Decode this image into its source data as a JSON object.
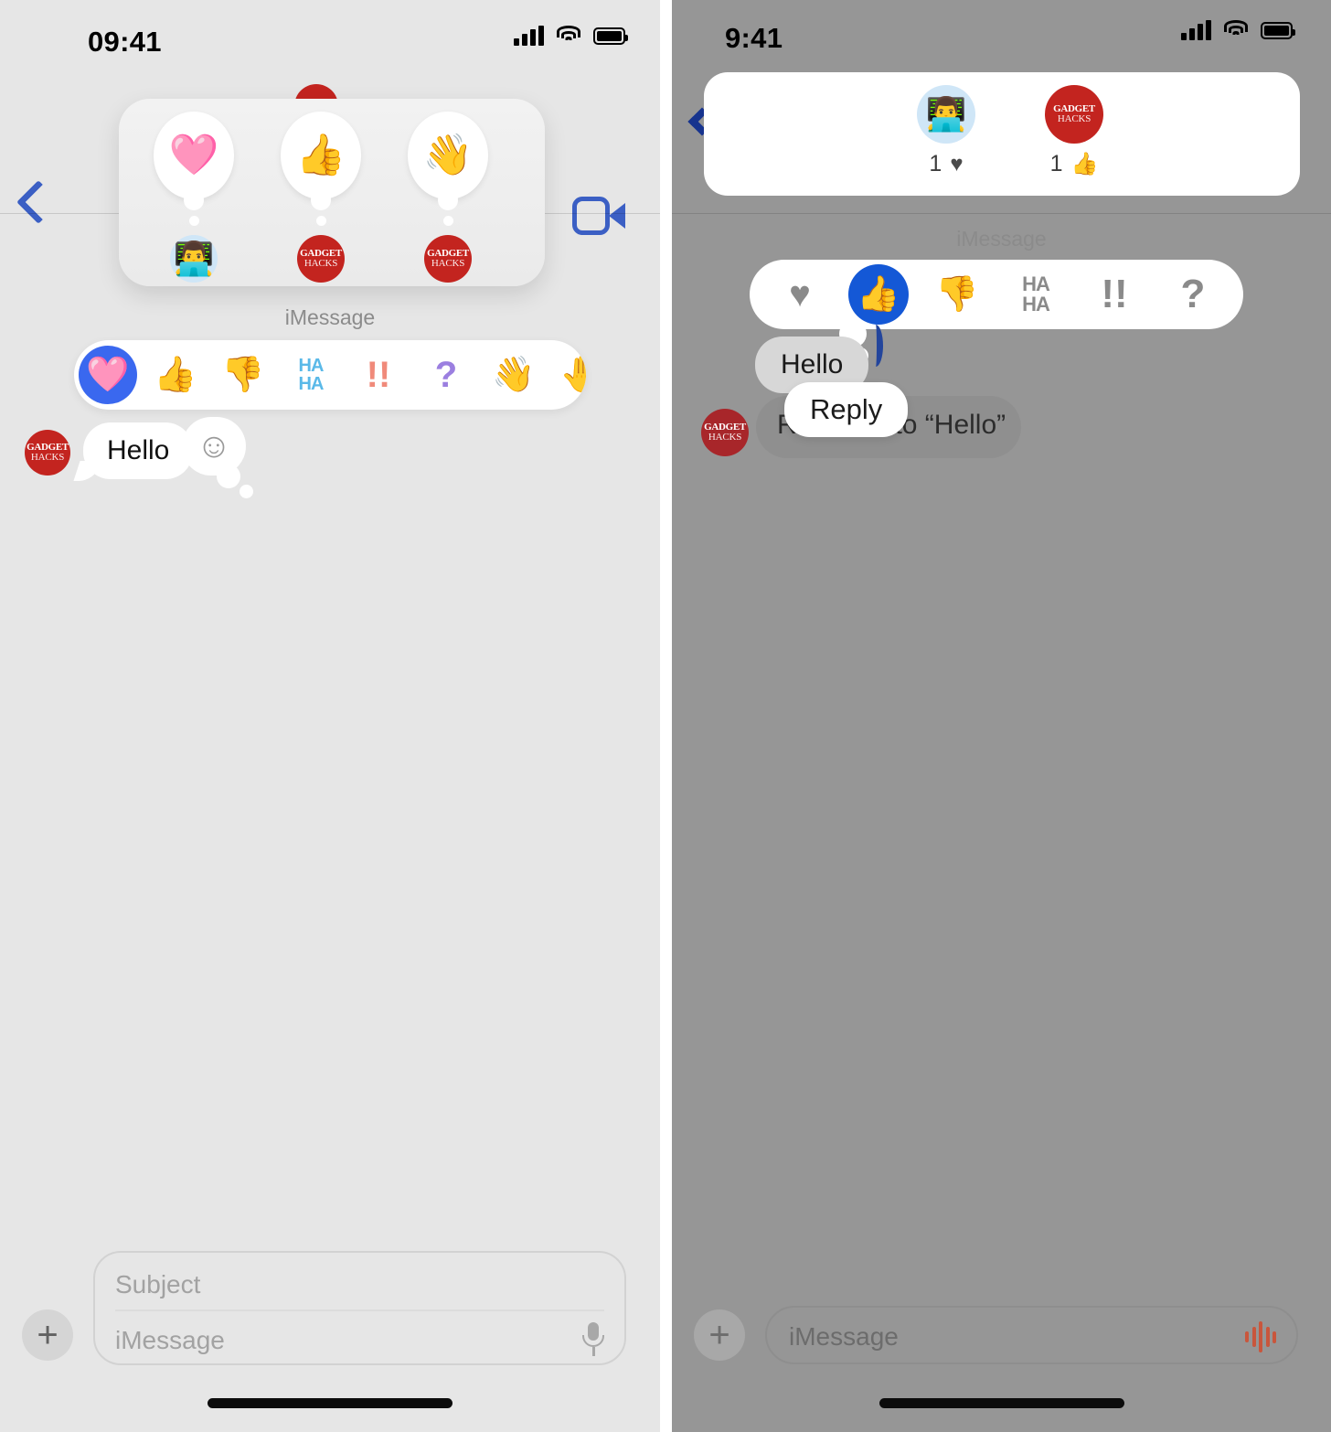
{
  "left_panel": {
    "status_bar": {
      "time": "09:41",
      "cellular_icon": "signal-bars-icon",
      "wifi_icon": "wifi-icon",
      "battery_icon": "battery-icon"
    },
    "nav": {
      "back_icon": "back-chevron-icon",
      "facetime_icon": "video-camera-icon"
    },
    "reaction_detail_popup": {
      "entries": [
        {
          "reaction": "🩷",
          "reaction_name": "pink-heart",
          "sender_avatar": "memoji-avatar",
          "sender_label": ""
        },
        {
          "reaction": "👍",
          "reaction_name": "thumbs-up",
          "sender_avatar": "gadget-hacks-avatar",
          "sender_label": "GADGET HACKS"
        },
        {
          "reaction": "👋",
          "reaction_name": "waving-hand",
          "sender_avatar": "gadget-hacks-avatar",
          "sender_label": "GADGET HACKS"
        }
      ]
    },
    "section_label": "iMessage",
    "tapback_bar": {
      "items": [
        {
          "name": "heart-reaction",
          "glyph": "🩷",
          "selected": true
        },
        {
          "name": "thumbs-up-reaction",
          "glyph": "👍",
          "selected": false
        },
        {
          "name": "thumbs-down-reaction",
          "glyph": "👎",
          "selected": false
        },
        {
          "name": "haha-reaction",
          "glyph": "HA\nHA",
          "selected": false
        },
        {
          "name": "exclamation-reaction",
          "glyph": "!!",
          "selected": false
        },
        {
          "name": "question-reaction",
          "glyph": "?",
          "selected": false
        },
        {
          "name": "wave-reaction",
          "glyph": "👋",
          "selected": false
        },
        {
          "name": "partial-reaction",
          "glyph": "🤚",
          "selected": false
        }
      ]
    },
    "message": {
      "avatar": "gadget-hacks-avatar",
      "text": "Hello",
      "sticker_icon": "smiley-face-icon"
    },
    "composer": {
      "add_button": "+",
      "subject_placeholder": "Subject",
      "message_placeholder": "iMessage",
      "mic_icon": "microphone-icon"
    },
    "avatar_logo": {
      "line1": "GADGET",
      "line2": "HACKS"
    }
  },
  "right_panel": {
    "status_bar": {
      "time": "9:41",
      "cellular_icon": "signal-bars-icon",
      "wifi_icon": "wifi-icon",
      "battery_icon": "battery-icon"
    },
    "nav": {
      "back_icon": "back-chevron-icon"
    },
    "reaction_summary_card": {
      "entries": [
        {
          "avatar": "memoji-avatar",
          "count": "1",
          "reaction_icon": "heart-icon",
          "reaction_glyph": "♥"
        },
        {
          "avatar": "gadget-hacks-avatar",
          "count": "1",
          "reaction_icon": "thumbs-up-icon",
          "reaction_glyph": "👍"
        }
      ]
    },
    "section_label": "iMessage",
    "tapback_bar": {
      "items": [
        {
          "name": "heart-reaction",
          "glyph": "♥",
          "selected": false
        },
        {
          "name": "thumbs-up-reaction",
          "glyph": "👍",
          "selected": true
        },
        {
          "name": "thumbs-down-reaction",
          "glyph": "👎",
          "selected": false
        },
        {
          "name": "haha-reaction",
          "glyph": "HA HA",
          "selected": false
        },
        {
          "name": "exclamation-reaction",
          "glyph": "!!",
          "selected": false
        },
        {
          "name": "question-reaction",
          "glyph": "?",
          "selected": false
        }
      ]
    },
    "conversation": {
      "incoming_text": "Hello",
      "reaction_notice": "to “Hello”",
      "reaction_notice_prefix": "R",
      "avatar": "gadget-hacks-avatar"
    },
    "context_menu": {
      "reply_label": "Reply"
    },
    "composer": {
      "add_button": "+",
      "message_placeholder": "iMessage",
      "audio_icon": "audio-waveform-icon"
    },
    "avatar_logo": {
      "line1": "GADGET",
      "line2": "HACKS"
    }
  },
  "colors": {
    "accent_blue": "#3a68ef",
    "selected_blue": "#1458d6",
    "brand_red": "#c3241f",
    "left_background": "#e6e6e6",
    "right_background": "#969696"
  }
}
